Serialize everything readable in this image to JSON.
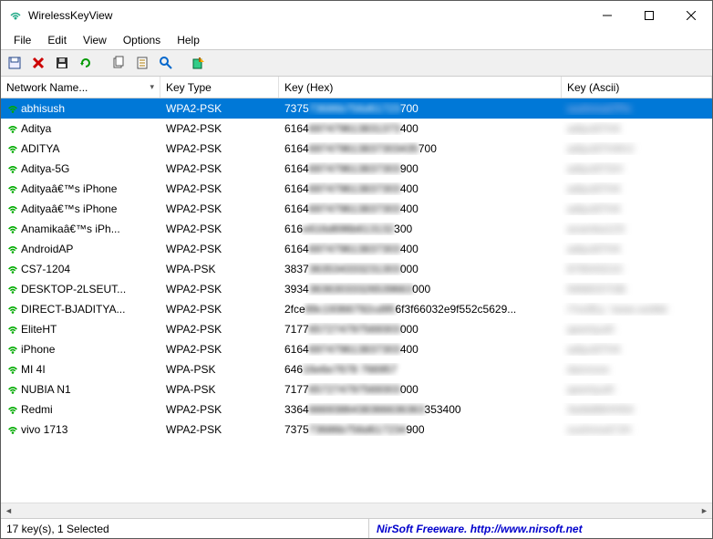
{
  "window": {
    "title": "WirelessKeyView"
  },
  "menu": {
    "items": [
      "File",
      "Edit",
      "View",
      "Options",
      "Help"
    ]
  },
  "columns": {
    "name": "Network Name...",
    "type": "Key Type",
    "hex": "Key (Hex)",
    "ascii": "Key (Ascii)"
  },
  "rows": [
    {
      "name": "abhisush",
      "type": "WPA2-PSK",
      "hex_pre": "7375",
      "hex_blur": "73686b756d61723",
      "hex_post": "700",
      "ascii": "sushmod7Pe",
      "selected": true
    },
    {
      "name": "Aditya",
      "type": "WPA2-PSK",
      "hex_pre": "6164",
      "hex_blur": "697479613831373",
      "hex_post": "400",
      "ascii": "adtyo87H4"
    },
    {
      "name": "ADITYA",
      "type": "WPA2-PSK",
      "hex_pre": "6164",
      "hex_blur": "697479613837303435",
      "hex_post": "700",
      "ascii": "adtyo87H4HJ"
    },
    {
      "name": "Aditya-5G",
      "type": "WPA2-PSK",
      "hex_pre": "6164",
      "hex_blur": "697479613837303",
      "hex_post": "900",
      "ascii": "adtyo87GH"
    },
    {
      "name": "Adityaâ€™s iPhone",
      "type": "WPA2-PSK",
      "hex_pre": "6164",
      "hex_blur": "697479613837303",
      "hex_post": "400",
      "ascii": "adtyo87H4"
    },
    {
      "name": "Adityaâ€™s iPhone",
      "type": "WPA2-PSK",
      "hex_pre": "6164",
      "hex_blur": "697479613837303",
      "hex_post": "400",
      "ascii": "adtyo87H4"
    },
    {
      "name": "Anamikaâ€™s iPh...",
      "type": "WPA2-PSK",
      "hex_pre": "616",
      "hex_blur": "e616d696b613132",
      "hex_post": "300",
      "ascii": "anamka123"
    },
    {
      "name": "AndroidAP",
      "type": "WPA2-PSK",
      "hex_pre": "6164",
      "hex_blur": "697479613837303",
      "hex_post": "400",
      "ascii": "adtyo87H4"
    },
    {
      "name": "CS7-1204",
      "type": "WPA-PSK",
      "hex_pre": "3837",
      "hex_blur": "363534333231303",
      "hex_post": "000",
      "ascii": "876543210"
    },
    {
      "name": "DESKTOP-2LSEUT...",
      "type": "WPA2-PSK",
      "hex_pre": "3934",
      "hex_blur": "36363033326539663",
      "hex_post": "000",
      "ascii": "9466037GB"
    },
    {
      "name": "DIRECT-BJADITYA...",
      "type": "WPA2-PSK",
      "hex_pre": "2fce",
      "hex_blur": "89c19366792cd95",
      "hex_post": "6f3f66032e9f552c5629...",
      "ascii": "/Yw3Ey: !wwe.wsMd"
    },
    {
      "name": "EliteHT",
      "type": "WPA2-PSK",
      "hex_pre": "7177",
      "hex_blur": "657274797569303",
      "hex_post": "000",
      "ascii": "qwertyui0"
    },
    {
      "name": "iPhone",
      "type": "WPA2-PSK",
      "hex_pre": "6164",
      "hex_blur": "697479613837303",
      "hex_post": "400",
      "ascii": "adtyo87H4"
    },
    {
      "name": "MI 4I",
      "type": "WPA-PSK",
      "hex_pre": "646",
      "hex_blur": "16e6e7678 766957",
      "hex_post": "",
      "ascii": "dannove"
    },
    {
      "name": "NUBIA N1",
      "type": "WPA-PSK",
      "hex_pre": "7177",
      "hex_blur": "657274797569303",
      "hex_post": "000",
      "ascii": "qwertyui0"
    },
    {
      "name": "Redmi",
      "type": "WPA2-PSK",
      "hex_pre": "3364",
      "hex_blur": "6669386438366636363",
      "hex_post": "353400",
      "ascii": "3w8d86HH54"
    },
    {
      "name": "vivo 1713",
      "type": "WPA2-PSK",
      "hex_pre": "7375",
      "hex_blur": "73686b756d617234",
      "hex_post": "900",
      "ascii": "sushmod7JH"
    }
  ],
  "status": {
    "left": "17 key(s), 1 Selected",
    "right_vendor": "NirSoft Freeware.  ",
    "right_url": "http://www.nirsoft.net"
  }
}
